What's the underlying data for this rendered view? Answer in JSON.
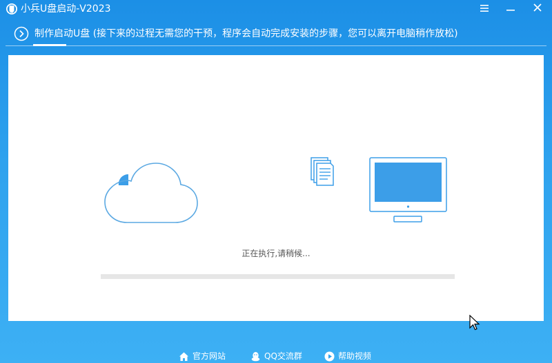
{
  "window": {
    "title": "小兵U盘启动-V2023",
    "controls": [
      "menu-icon",
      "minimize-icon",
      "close-icon"
    ]
  },
  "header": {
    "step_text": "制作启动U盘 (接下来的过程无需您的干预，程序会自动完成安装的步骤，您可以离开电脑稍作放松)",
    "step_icon": "chevron-right-circle-icon"
  },
  "main": {
    "illustrations": [
      "cloud-icon",
      "document-icon",
      "monitor-icon"
    ],
    "status_text": "正在执行,请稍候...",
    "progress": 0
  },
  "footer": {
    "links": [
      {
        "label": "官方网站",
        "icon": "home-icon"
      },
      {
        "label": "QQ交流群",
        "icon": "qq-penguin-icon"
      },
      {
        "label": "帮助视频",
        "icon": "play-circle-icon"
      }
    ]
  },
  "colors": {
    "accent": "#1c8fe6",
    "illustration_blue": "#3c9ee8",
    "panel": "#ffffff"
  }
}
